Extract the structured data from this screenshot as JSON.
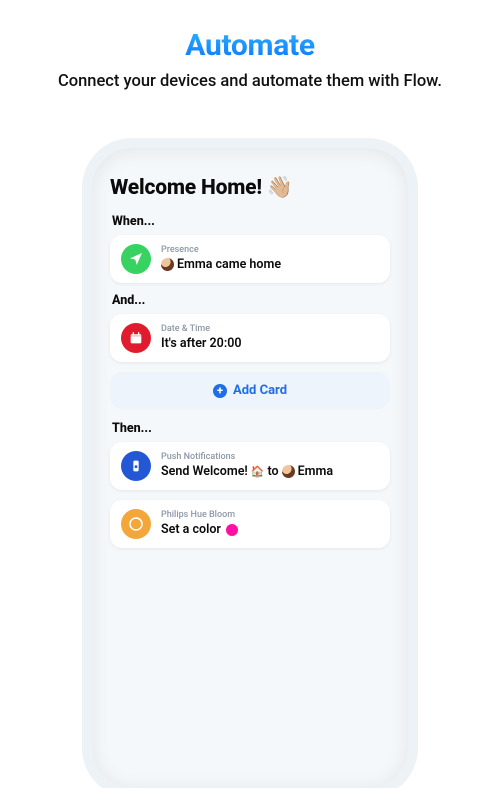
{
  "hero": {
    "title": "Automate",
    "subtitle": "Connect your devices and automate them with Flow."
  },
  "screen": {
    "title": "Welcome Home! 👋🏼"
  },
  "sections": {
    "when": {
      "label": "When...",
      "card": {
        "eyebrow": "Presence",
        "actor": "Emma",
        "text_after": "came home"
      }
    },
    "and": {
      "label": "And...",
      "card": {
        "eyebrow": "Date & Time",
        "text": "It's after 20:00"
      },
      "add_label": "Add Card"
    },
    "then": {
      "label": "Then...",
      "card1": {
        "eyebrow": "Push Notifications",
        "text_prefix": "Send Welcome!",
        "house": "🏠",
        "to": "to",
        "actor": "Emma"
      },
      "card2": {
        "eyebrow": "Philips Hue Bloom",
        "text": "Set a color"
      }
    }
  },
  "icons": {
    "presence_bg": "#36d360",
    "datetime_bg": "#e11b2e",
    "push_bg": "#2457d6",
    "bloom_bg": "#f3a63a"
  }
}
